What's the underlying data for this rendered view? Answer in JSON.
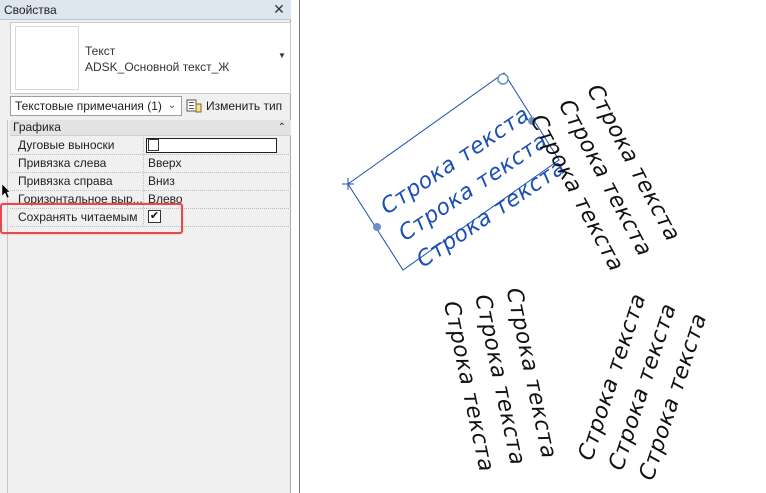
{
  "panel": {
    "title": "Свойства",
    "close_label": "✕",
    "type_name": "Текст",
    "type_subname": "ADSK_Основной текст_Ж",
    "filter_value": "Текстовые примечания (1)",
    "edit_type_label": "Изменить тип",
    "group_label": "Графика",
    "properties": [
      {
        "name": "Дуговые выноски",
        "value": ""
      },
      {
        "name": "Привязка слева",
        "value": "Вверх"
      },
      {
        "name": "Привязка справа",
        "value": "Вниз"
      },
      {
        "name": "Горизонтальное выр...",
        "value": "Влево"
      },
      {
        "name": "Сохранять читаемым",
        "value": "✔"
      }
    ]
  },
  "canvas": {
    "notes": [
      {
        "lines": [
          "Строка текста",
          "Строка текста",
          "Строка текста"
        ]
      },
      {
        "lines": [
          "Строка текста",
          "Строка текста",
          "Строка текста"
        ]
      },
      {
        "lines": [
          "Строка текста",
          "Строка текста",
          "Строка текста"
        ]
      },
      {
        "lines": [
          "Строка текста",
          "Строка текста",
          "Строка текста"
        ]
      }
    ]
  },
  "colors": {
    "selection": "#1b4fb5",
    "highlight": "#e8474c",
    "grip": "#6c8fc4"
  },
  "icons": [
    "close-icon",
    "chevron-down-icon",
    "edit-type-icon",
    "collapse-icon",
    "checkmark-icon",
    "cursor-icon",
    "grip-icon",
    "rotate-grip-icon",
    "move-icon"
  ]
}
